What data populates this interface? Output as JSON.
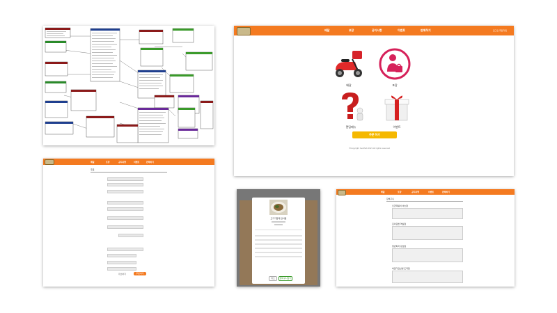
{
  "main": {
    "nav": [
      "배달",
      "포장",
      "공지사항",
      "이벤트",
      "판매하기"
    ],
    "user_links": "로그인 회원가입",
    "tiles": [
      {
        "label": "배달",
        "icon": "scooter-icon"
      },
      {
        "label": "포장",
        "icon": "takeout-person-icon"
      },
      {
        "label": "랜덤메뉴",
        "icon": "question-mark-icon"
      },
      {
        "label": "이벤트",
        "icon": "gift-box-icon"
      }
    ],
    "order_button": "주문 하기",
    "footer": "©Copyright foodhub 2021 All rights reserved"
  },
  "colors": {
    "header": "#f47a20",
    "order_button": "#f5b800",
    "erd_red": "#8b1a1a",
    "erd_blue": "#1f3f8f",
    "erd_green": "#3a9a2a",
    "erd_purple": "#6a2a9a"
  },
  "form": {
    "nav": [
      "배달",
      "포장",
      "공지사항",
      "이벤트",
      "판매하기"
    ],
    "section_title": "주문",
    "cancel_label": "취소하기",
    "submit_label": "주문하기"
  },
  "modal": {
    "title": "고기가함께 김치찜",
    "cancel": "취소",
    "confirm": "장바구니담기"
  },
  "cart": {
    "nav": [
      "배달",
      "포장",
      "공지사항",
      "이벤트",
      "판매하기"
    ],
    "title": "장바구니",
    "stores": [
      "오즈떡볶이 서초점",
      "모아김밥 역삼점",
      "청년피자 강남점",
      "바르다김선생 도곡점"
    ]
  }
}
